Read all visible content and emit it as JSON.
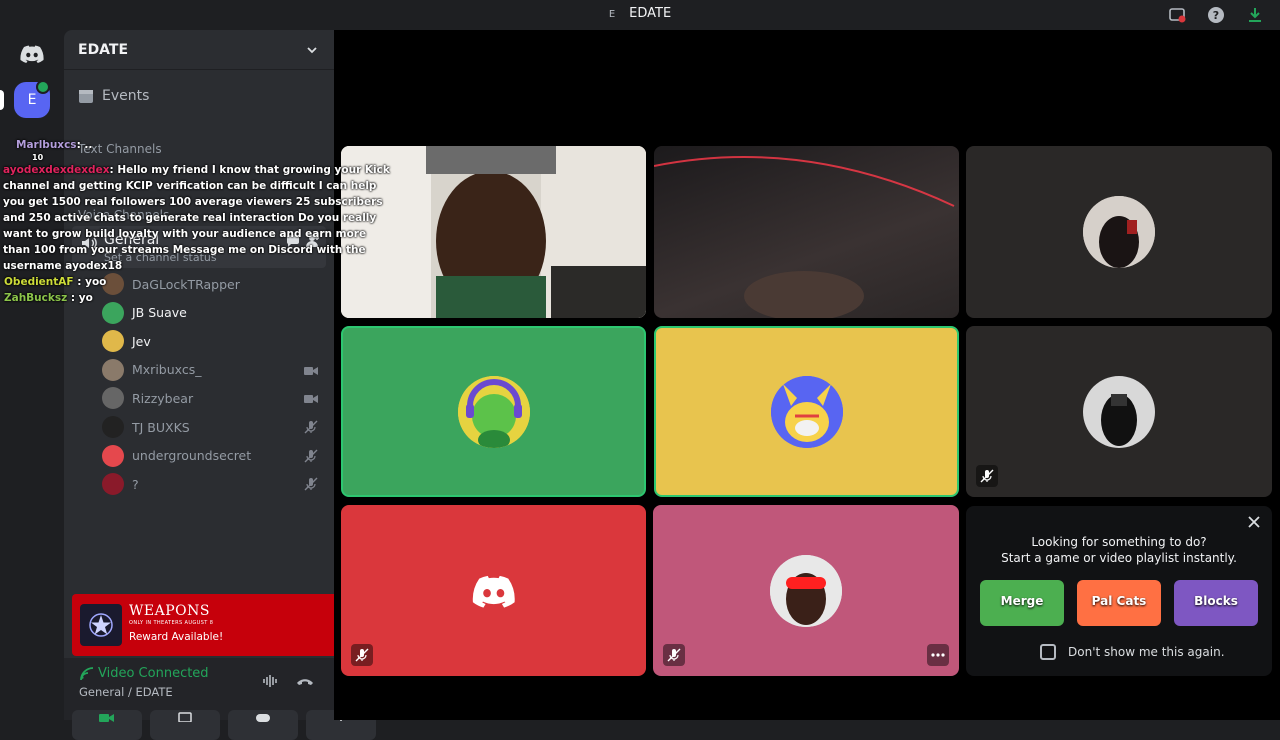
{
  "window": {
    "server_badge": "E",
    "title": "EDATE"
  },
  "rail": {
    "server_initial": "E"
  },
  "sidebar": {
    "server_name": "EDATE",
    "events_label": "Events",
    "text_channels_label": "Text Channels",
    "voice_channels_label": "Voice Channels",
    "voice_channel": {
      "name": "General",
      "status_placeholder": "Set a channel status"
    },
    "members": [
      {
        "name": "DaGLockTRapper",
        "color": "#6b4f3a",
        "bright": false,
        "icon": "none"
      },
      {
        "name": "JB Suave",
        "color": "#3ba55d",
        "bright": true,
        "icon": "none"
      },
      {
        "name": "Jev",
        "color": "#e0b84a",
        "bright": true,
        "icon": "none"
      },
      {
        "name": "Mxribuxcs_",
        "color": "#8a7a6a",
        "bright": false,
        "icon": "camera"
      },
      {
        "name": "Rizzybear",
        "color": "#666666",
        "bright": false,
        "icon": "camera"
      },
      {
        "name": "TJ BUXKS",
        "color": "#222222",
        "bright": false,
        "icon": "mic-off"
      },
      {
        "name": "undergroundsecret",
        "color": "#e5484d",
        "bright": false,
        "icon": "mic-off"
      },
      {
        "name": "?",
        "color": "#8a1a2a",
        "bright": false,
        "icon": "mic-off"
      }
    ]
  },
  "chat_overlay": [
    {
      "user": "Marlbuxcs",
      "sep": ": ..",
      "text": "",
      "badge": "10"
    },
    {
      "user": "ayodexdexdexdex",
      "sep": ": ",
      "text": "Hello my friend I know that growing your Kick channel and getting KCIP verification can be difficult I can help you get 1500 real followers 100 average viewers 25 subscribers and 250 active chats to generate real interaction Do you really want to grow build loyalty with your audience and earn more than 100 from your streams Message me on Discord with the username ayodex18",
      "badge": ""
    },
    {
      "user": "ObedientAF",
      "sep": " : ",
      "text": "yoo",
      "badge": ""
    },
    {
      "user": "ZahBucksz",
      "sep": " : ",
      "text": "yo",
      "badge": ""
    }
  ],
  "promo": {
    "title": "WEAPONS",
    "subtitle": "ONLY IN THEATERS AUGUST 8",
    "reward": "Reward Available!"
  },
  "voice_status": {
    "title": "Video Connected",
    "subtitle": "General / EDATE"
  },
  "activity": {
    "line1": "Looking for something to do?",
    "line2": "Start a game or video playlist instantly.",
    "games": [
      {
        "name": "Merge",
        "color": "#4caf50"
      },
      {
        "name": "Pal Cats",
        "color": "#ff7043"
      },
      {
        "name": "Blocks",
        "color": "#7e57c2"
      }
    ],
    "dont_show": "Don't show me this again."
  },
  "colors": {
    "accent": "#5865f2",
    "green": "#23a55a",
    "yellow_tile": "#e8c44e",
    "red_tile": "#da373c",
    "pink_tile": "#c0577a",
    "green_tile": "#3ba55d"
  }
}
